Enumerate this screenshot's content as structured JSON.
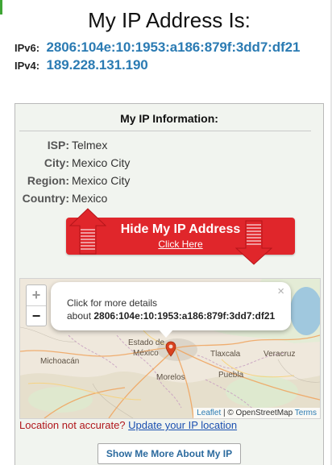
{
  "header": {
    "title": "My IP Address Is:",
    "ipv6_label": "IPv6:",
    "ipv6_value": "2806:104e:10:1953:a186:879f:3dd7:df21",
    "ipv4_label": "IPv4:",
    "ipv4_value": "189.228.131.190"
  },
  "info_panel": {
    "title": "My IP Information:",
    "rows": [
      {
        "key": "ISP:",
        "value": "Telmex"
      },
      {
        "key": "City:",
        "value": "Mexico City"
      },
      {
        "key": "Region:",
        "value": "Mexico City"
      },
      {
        "key": "Country:",
        "value": "Mexico"
      }
    ]
  },
  "hide_button": {
    "label": "Hide My IP Address",
    "sublabel": "Click Here"
  },
  "map": {
    "zoom_in": "+",
    "zoom_out": "−",
    "popup_line1": "Click for more details",
    "popup_prefix": "about",
    "popup_ip": "2806:104e:10:1953:a186:879f:3dd7:df21",
    "popup_close": "×",
    "labels": {
      "michoacan": "Michoacán",
      "estado_de": "Estado de",
      "mexico": "México",
      "tlaxcala": "Tlaxcala",
      "veracruz": "Veracruz",
      "morelos": "Morelos",
      "puebla": "Puebla"
    },
    "attribution": {
      "leaflet": "Leaflet",
      "separator": "|",
      "osm": "© OpenStreetMap",
      "terms": "Terms"
    }
  },
  "location": {
    "prompt": "Location not accurate?",
    "link": "Update your IP location"
  },
  "more_button": {
    "label": "Show Me More About My IP"
  },
  "colors": {
    "ip_blue": "#2b7bb3",
    "button_red": "#e0262b",
    "panel_bg": "#f1f4ef",
    "accent_green": "#3fa535"
  },
  "icons": {
    "map_marker": "map-marker-icon",
    "arrow_up": "red-arrow-up-icon",
    "arrow_down": "red-arrow-down-icon",
    "close": "close-icon"
  }
}
